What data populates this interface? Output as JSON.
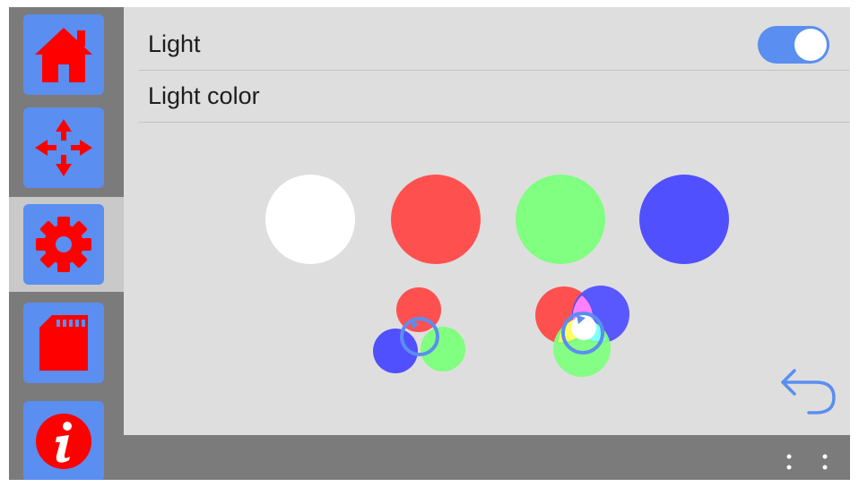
{
  "sidebar": {
    "items": [
      {
        "id": "home",
        "icon": "home-icon",
        "active": false
      },
      {
        "id": "move",
        "icon": "move-arrows-icon",
        "active": false
      },
      {
        "id": "settings",
        "icon": "gear-icon",
        "active": true
      },
      {
        "id": "sd-card",
        "icon": "sd-card-icon",
        "active": false
      },
      {
        "id": "info",
        "icon": "info-icon",
        "active": false
      }
    ]
  },
  "settings": {
    "light": {
      "label": "Light",
      "enabled": true
    },
    "light_color": {
      "label": "Light color"
    }
  },
  "color_options": [
    {
      "name": "white",
      "color": "#ffffff"
    },
    {
      "name": "red",
      "color": "#ff5050"
    },
    {
      "name": "green",
      "color": "#80ff80"
    },
    {
      "name": "blue",
      "color": "#5050ff"
    }
  ],
  "modes": [
    {
      "name": "rgb-cycle",
      "icon": "rgb-cycle-icon"
    },
    {
      "name": "rgb-mix",
      "icon": "rgb-mix-icon"
    }
  ],
  "colors": {
    "accent": "#5a8ef0",
    "icon_red": "#ff0000",
    "panel_bg": "#dedede",
    "frame_bg": "#7b7b7b",
    "active_nav_bg": "#c9c9c9"
  }
}
